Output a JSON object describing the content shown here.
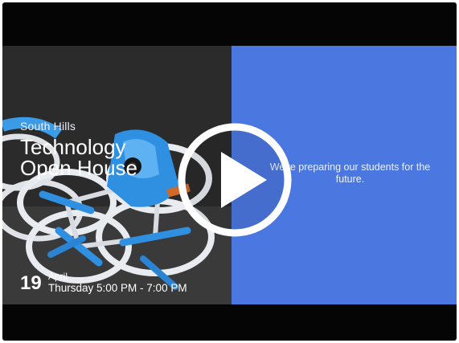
{
  "video": {
    "organization": "South Hills",
    "title_line1": "Technology",
    "title_line2": "Open House",
    "event_day": "19",
    "event_month": "April",
    "event_time": "Thursday 5:00 PM - 7:00 PM",
    "tagline": "We're preparing our students for the future.",
    "play_icon": "play-icon",
    "colors": {
      "panel": "#4b77e0",
      "letterbox": "#050505",
      "drone_blue": "#2f8fe0",
      "guard_white": "#e8ecf0"
    }
  }
}
